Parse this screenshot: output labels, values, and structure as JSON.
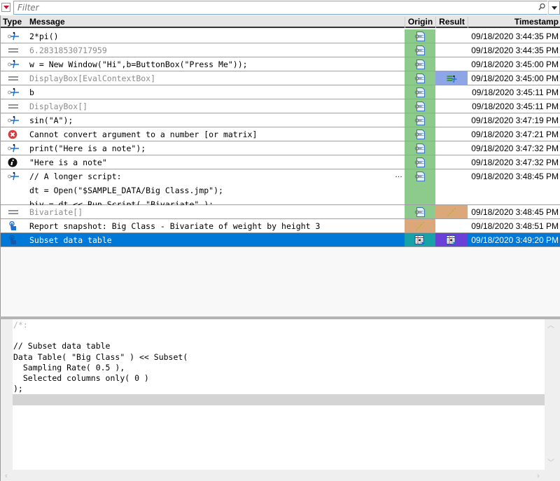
{
  "filter": {
    "placeholder": "Filter",
    "value": ""
  },
  "columns": {
    "type": "Type",
    "message": "Message",
    "origin": "Origin",
    "result": "Result",
    "timestamp": "Timestamp"
  },
  "colors": {
    "selected_row": "#0078d7",
    "origin_script": "#8ccb8c",
    "result_display": "#8ea6e8",
    "report_snapshot": "#dca87a",
    "data_table_origin": "#17a2a8",
    "data_table_result": "#6a40d8"
  },
  "rows": [
    {
      "type": "script-entry",
      "message": "2*pi()",
      "style": "input",
      "origin": "script",
      "result": "",
      "timestamp": "09/18/2020 3:44:35 PM"
    },
    {
      "type": "result",
      "message": "6.28318530717959",
      "style": "result",
      "origin": "script",
      "result": "",
      "timestamp": "09/18/2020 3:44:35 PM"
    },
    {
      "type": "script-entry",
      "message": "w = New Window(\"Hi\",b=ButtonBox(\"Press Me\"));",
      "style": "input",
      "origin": "script",
      "result": "",
      "timestamp": "09/18/2020 3:45:00 PM"
    },
    {
      "type": "result",
      "message": "DisplayBox[EvalContextBox]",
      "style": "result",
      "origin": "script",
      "result": "display-box",
      "timestamp": "09/18/2020 3:45:00 PM"
    },
    {
      "type": "script-entry",
      "message": "b",
      "style": "input",
      "origin": "script",
      "result": "",
      "timestamp": "09/18/2020 3:45:11 PM"
    },
    {
      "type": "result",
      "message": "DisplayBox[]",
      "style": "result",
      "origin": "script",
      "result": "",
      "timestamp": "09/18/2020 3:45:11 PM"
    },
    {
      "type": "script-entry",
      "message": "sin(\"A\");",
      "style": "input",
      "origin": "script",
      "result": "",
      "timestamp": "09/18/2020 3:47:19 PM"
    },
    {
      "type": "error",
      "message": "Cannot convert argument to a number [or matrix]",
      "style": "input",
      "origin": "script",
      "result": "",
      "timestamp": "09/18/2020 3:47:21 PM"
    },
    {
      "type": "script-entry",
      "message": "print(\"Here is a note\");",
      "style": "input",
      "origin": "script",
      "result": "",
      "timestamp": "09/18/2020 3:47:32 PM"
    },
    {
      "type": "info",
      "message": "\"Here is a note\"",
      "style": "input",
      "origin": "script",
      "result": "",
      "timestamp": "09/18/2020 3:47:32 PM"
    },
    {
      "type": "script-entry",
      "message": "// A longer script:\ndt = Open(\"$SAMPLE_DATA/Big Class.jmp\");\nbiv = dt << Run Script( \"Bivariate\" );",
      "style": "input",
      "origin": "script",
      "result": "",
      "timestamp": "09/18/2020 3:48:45 PM",
      "truncated": true
    },
    {
      "type": "result",
      "message": "Bivariate[]",
      "style": "result",
      "origin": "script",
      "result": "report",
      "timestamp": "09/18/2020 3:48:45 PM"
    },
    {
      "type": "user-action",
      "message": "Report snapshot: Big Class - Bivariate of weight by height 3",
      "style": "input",
      "origin": "report",
      "result": "",
      "timestamp": "09/18/2020 3:48:51 PM"
    },
    {
      "type": "user-action",
      "message": "Subset data table",
      "style": "input",
      "origin": "data-table",
      "result": "data-table",
      "timestamp": "09/18/2020 3:49:20 PM",
      "selected": true
    }
  ],
  "more_indicator": "…",
  "editor": {
    "lines": [
      "/*:",
      "",
      "// Subset data table",
      "Data Table( \"Big Class\" ) << Subset(",
      "  Sampling Rate( 0.5 ),",
      "  Selected columns only( 0 )",
      ");",
      ""
    ]
  }
}
